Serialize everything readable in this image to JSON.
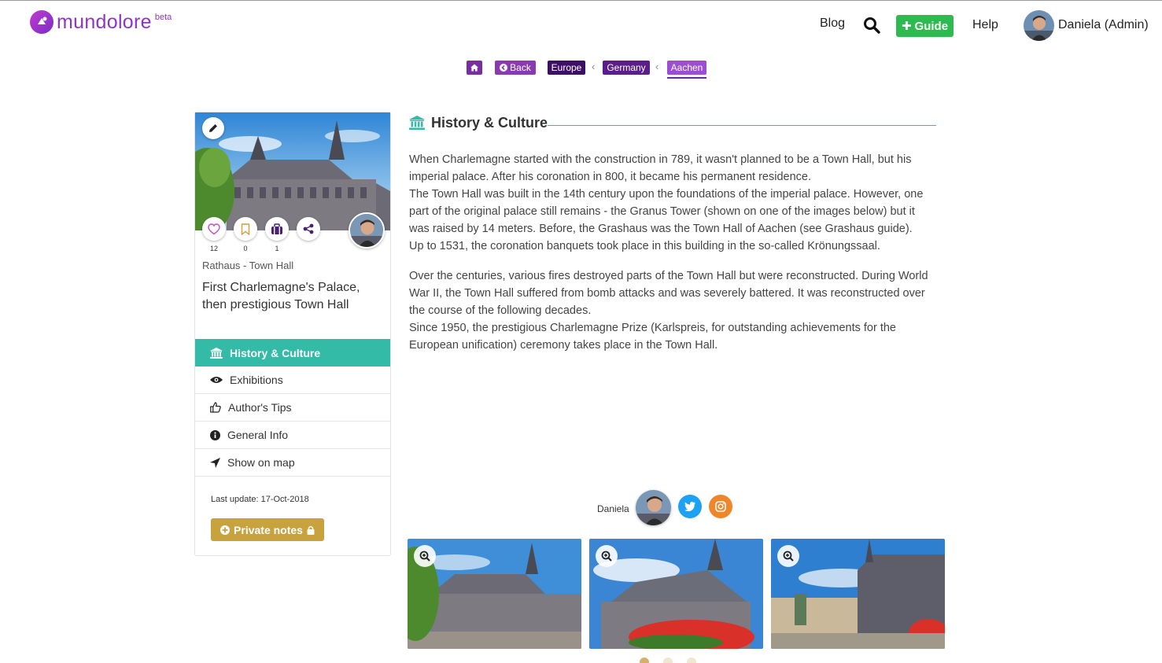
{
  "header": {
    "logo_text": "mundolore",
    "logo_badge": "beta",
    "nav": {
      "blog": "Blog",
      "guide": "Guide",
      "help": "Help",
      "user": "Daniela (Admin)"
    }
  },
  "breadcrumb": {
    "back": "Back",
    "items": [
      "Europe",
      "Germany",
      "Aachen"
    ]
  },
  "place": {
    "counts": {
      "likes": "12",
      "saved": "0",
      "guides": "1"
    },
    "category": "Rathaus - Town Hall",
    "title": "First Charlemagne's Palace, then prestigious Town Hall"
  },
  "menu": {
    "items": [
      {
        "label": "History & Culture",
        "icon": "bank-icon"
      },
      {
        "label": "Exhibitions",
        "icon": "eye-icon"
      },
      {
        "label": "Author's Tips",
        "icon": "thumbs-up-icon"
      },
      {
        "label": "General Info",
        "icon": "info-icon"
      },
      {
        "label": "Show on map",
        "icon": "location-arrow-icon"
      }
    ],
    "active": "History & Culture"
  },
  "meta": {
    "last_update": "Last update: 17-Oct-2018",
    "private_notes": "Private notes"
  },
  "section": {
    "title": "History & Culture",
    "paragraphs": [
      "When Charlemagne started with the construction in 789, it wasn't planned to be a Town Hall, but his imperial palace. After his coronation in 800, it became his permanent residence.",
      "The Town Hall was built in the 14th century upon the foundations of the imperial palace. However, one part of the original palace still remains - the Granus Tower (shown on one of the images below) but it was raised by 14 meters. Before, the Grashaus was the Town Hall of Aachen (see Grashaus guide).",
      "Up to 1531, the coronation banquets took place in this building in the so-called Krönungssaal.",
      "Over the centuries, various fires destroyed parts of the Town Hall but were reconstructed. During World War II, the Town Hall suffered from bomb attacks and was severely battered. It was reconstructed over the course of the following decades.",
      "Since 1950, the prestigious Charlemagne Prize (Karlspreis, for outstanding achievements for the European unification) ceremony takes place in the Town Hall."
    ]
  },
  "author": {
    "name": "Daniela"
  },
  "gallery": {
    "image_count": 3,
    "active_dot": 0
  },
  "colors": {
    "brand_purple": "#8e35c9",
    "accent_teal": "#33bba7",
    "guide_green": "#2dbb4f",
    "notes_gold": "#c7a23d",
    "twitter_blue": "#1da1f2",
    "instagram_orange": "#f0862a"
  }
}
